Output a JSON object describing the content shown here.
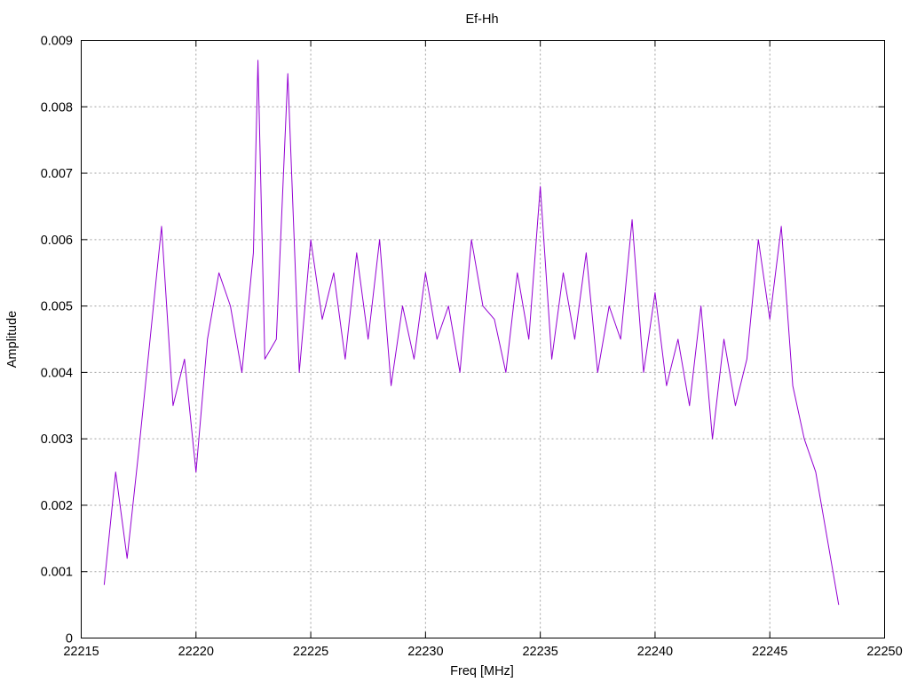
{
  "chart_data": {
    "type": "line",
    "title": "Ef-Hh",
    "xlabel": "Freq [MHz]",
    "ylabel": "Amplitude",
    "xlim": [
      22215,
      22250
    ],
    "ylim": [
      0,
      0.009
    ],
    "x_ticks": [
      22215,
      22220,
      22225,
      22230,
      22235,
      22240,
      22245,
      22250
    ],
    "x_tick_labels": [
      "22215",
      "22220",
      "22225",
      "22230",
      "22235",
      "22240",
      "22245",
      "22250"
    ],
    "y_ticks": [
      0,
      0.001,
      0.002,
      0.003,
      0.004,
      0.005,
      0.006,
      0.007,
      0.008,
      0.009
    ],
    "y_tick_labels": [
      "0",
      "0.001",
      "0.002",
      "0.003",
      "0.004",
      "0.005",
      "0.006",
      "0.007",
      "0.008",
      "0.009"
    ],
    "grid": true,
    "line_color": "#9400d3",
    "series": [
      {
        "x": [
          22216.0,
          22216.5,
          22217.0,
          22217.5,
          22218.0,
          22218.5,
          22219.0,
          22219.5,
          22220.0,
          22220.5,
          22221.0,
          22221.5,
          22222.0,
          22222.5,
          22222.7,
          22223.0,
          22223.5,
          22224.0,
          22224.5,
          22225.0,
          22225.5,
          22226.0,
          22226.5,
          22227.0,
          22227.5,
          22228.0,
          22228.5,
          22229.0,
          22229.5,
          22230.0,
          22230.5,
          22231.0,
          22231.5,
          22232.0,
          22232.5,
          22233.0,
          22233.5,
          22234.0,
          22234.5,
          22235.0,
          22235.5,
          22236.0,
          22236.5,
          22237.0,
          22237.5,
          22238.0,
          22238.5,
          22239.0,
          22239.5,
          22240.0,
          22240.5,
          22241.0,
          22241.5,
          22242.0,
          22242.5,
          22243.0,
          22243.5,
          22244.0,
          22244.5,
          22245.0,
          22245.5,
          22246.0,
          22246.5,
          22247.0,
          22247.5,
          22248.0
        ],
        "y": [
          0.0008,
          0.0025,
          0.0012,
          0.0028,
          0.0045,
          0.0062,
          0.0035,
          0.0042,
          0.0025,
          0.0045,
          0.0055,
          0.005,
          0.004,
          0.0058,
          0.0087,
          0.0042,
          0.0045,
          0.0085,
          0.004,
          0.006,
          0.0048,
          0.0055,
          0.0042,
          0.0058,
          0.0045,
          0.006,
          0.0038,
          0.005,
          0.0042,
          0.0055,
          0.0045,
          0.005,
          0.004,
          0.006,
          0.005,
          0.0048,
          0.004,
          0.0055,
          0.0045,
          0.0068,
          0.0042,
          0.0055,
          0.0045,
          0.0058,
          0.004,
          0.005,
          0.0045,
          0.0063,
          0.004,
          0.0052,
          0.0038,
          0.0045,
          0.0035,
          0.005,
          0.003,
          0.0045,
          0.0035,
          0.0042,
          0.006,
          0.0048,
          0.0062,
          0.0038,
          0.003,
          0.0025,
          0.0015,
          0.0005
        ]
      }
    ]
  }
}
